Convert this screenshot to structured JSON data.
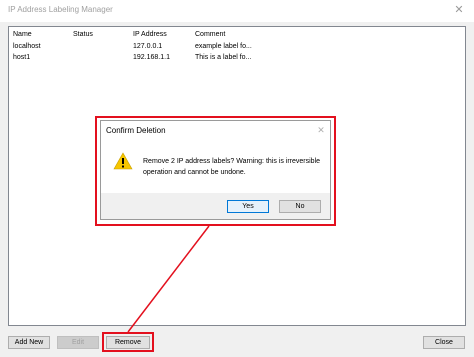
{
  "window": {
    "title": "IP Address Labeling Manager",
    "close_glyph": "✕"
  },
  "list": {
    "columns": [
      "Name",
      "Status",
      "IP Address",
      "Comment"
    ],
    "rows": [
      [
        "localhost",
        "",
        "127.0.0.1",
        "example label fo..."
      ],
      [
        "host1",
        "",
        "192.168.1.1",
        "This is a label fo..."
      ]
    ]
  },
  "buttons": {
    "add": "Add New",
    "edit": "Edit",
    "remove": "Remove",
    "close": "Close"
  },
  "dialog": {
    "title": "Confirm Deletion",
    "close_glyph": "✕",
    "icon": "warning-icon",
    "message": "Remove 2 IP address labels? Warning: this is irreversible operation and cannot be undone.",
    "yes": "Yes",
    "no": "No"
  },
  "colors": {
    "highlight": "#e3101e",
    "warning": "#f7c600",
    "focus": "#0078d7"
  }
}
